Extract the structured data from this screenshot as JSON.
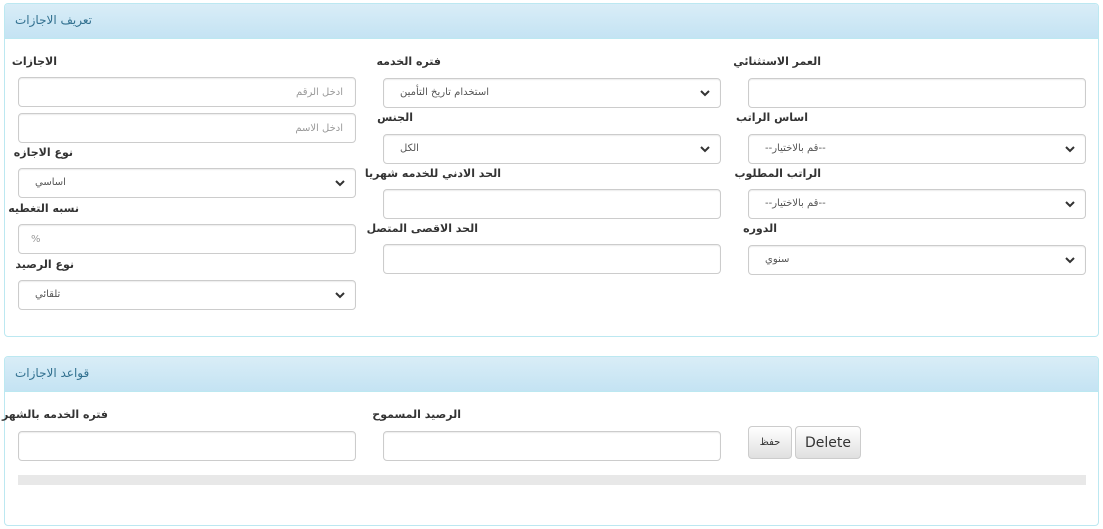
{
  "section_definition": {
    "title": "تعريف الاجازات",
    "col_right": {
      "exceptional_age": {
        "label": "العمر الاستثنائي",
        "value": ""
      },
      "salary_basis": {
        "label": "اساس الراتب",
        "selected": "--قم بالاختيار--"
      },
      "required_salary": {
        "label": "الراتب المطلوب",
        "selected": "--قم بالاختيار--"
      },
      "period": {
        "label": "الدوره",
        "selected": "سنوي"
      }
    },
    "col_middle": {
      "service_period": {
        "label": "فتره الخدمه",
        "selected": "استخدام تاريخ التأمين"
      },
      "gender": {
        "label": "الجنس",
        "selected": "الكل"
      },
      "min_monthly_service": {
        "label": "الحد الادني للخدمه شهريا",
        "value": ""
      },
      "max_continuous": {
        "label": "الحد الاقصى المتصل",
        "value": ""
      }
    },
    "col_left": {
      "leaves": {
        "label": "الاجازات",
        "number_placeholder": "ادخل الرقم",
        "name_placeholder": "ادخل الاسم"
      },
      "leave_type": {
        "label": "نوع الاجازه",
        "selected": "اساسي"
      },
      "coverage_ratio": {
        "label": "نسبه التغطيه",
        "placeholder": "%"
      },
      "balance_type": {
        "label": "نوع الرصيد",
        "selected": "تلقائي"
      }
    }
  },
  "section_rules": {
    "title": "قواعد الاجازات",
    "allowed_balance": {
      "label": "الرصيد المسموح",
      "value": ""
    },
    "service_months": {
      "label": "فتره الخدمه بالشهر",
      "value": ""
    },
    "save_label": "حفظ",
    "delete_label": "Delete"
  }
}
